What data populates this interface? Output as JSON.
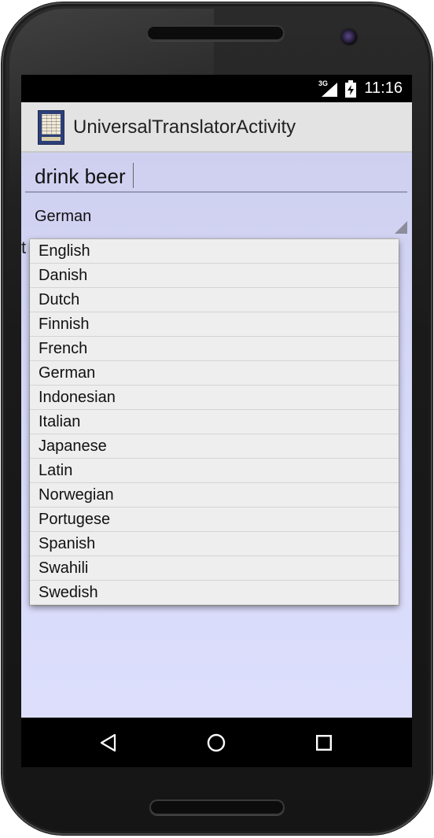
{
  "status_bar": {
    "network": "3G",
    "time": "11:16",
    "icons": [
      "signal-icon",
      "battery-charging-icon"
    ]
  },
  "action_bar": {
    "title": "UniversalTranslatorActivity",
    "icon": "app-icon"
  },
  "main": {
    "input_value": "drink beer",
    "spinner_selected": "German",
    "partial_text": "t"
  },
  "dropdown": {
    "items": [
      "English",
      "Danish",
      "Dutch",
      "Finnish",
      "French",
      "German",
      "Indonesian",
      "Italian",
      "Japanese",
      "Latin",
      "Norwegian",
      "Portugese",
      "Spanish",
      "Swahili",
      "Swedish"
    ]
  },
  "nav_bar": {
    "icons": [
      "back-icon",
      "home-icon",
      "recents-icon"
    ]
  },
  "colors": {
    "background": "#d6d8f8",
    "action_bar": "#e3e3e3",
    "dropdown": "#eeeeee"
  }
}
